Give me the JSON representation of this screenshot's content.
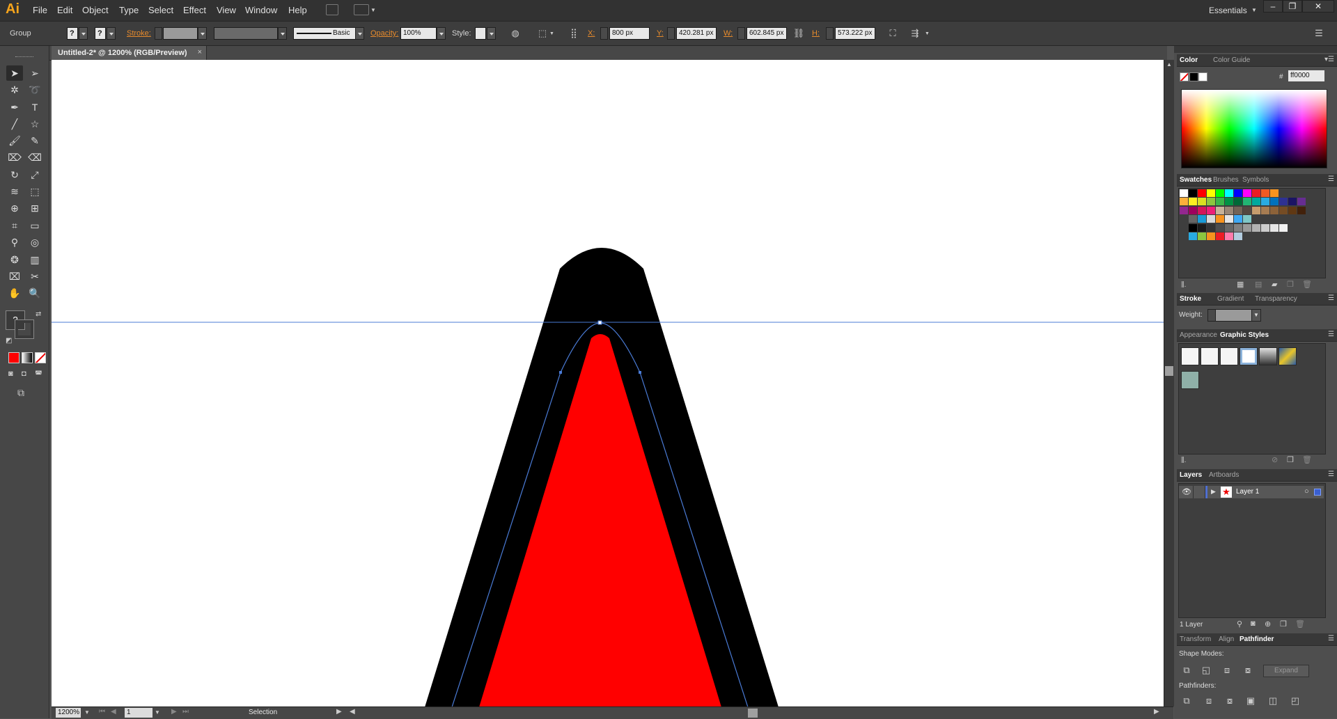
{
  "app": {
    "logo": "Ai"
  },
  "menu": [
    "File",
    "Edit",
    "Object",
    "Type",
    "Select",
    "Effect",
    "View",
    "Window",
    "Help"
  ],
  "workspace": {
    "label": "Essentials"
  },
  "window_buttons": [
    "–",
    "❐",
    "✕"
  ],
  "control_bar": {
    "selection_type": "Group",
    "stroke_label": "Stroke:",
    "brush_label": "Basic",
    "opacity_label": "Opacity:",
    "opacity_value": "100%",
    "style_label": "Style:",
    "x_label": "X:",
    "x_value": "800 px",
    "y_label": "Y:",
    "y_value": "420.281 px",
    "w_label": "W:",
    "w_value": "602.845 px",
    "h_label": "H:",
    "h_value": "573.222 px"
  },
  "document": {
    "tab_title": "Untitled-2* @ 1200% (RGB/Preview)",
    "close_glyph": "×",
    "fill_color": "#ff0000",
    "stroke_color": "#000000",
    "guide_color": "#4a7bd6"
  },
  "status_bar": {
    "zoom": "1200%",
    "artboard": "1",
    "tool": "Selection"
  },
  "panels": {
    "color": {
      "tabs": [
        "Color",
        "Color Guide"
      ],
      "hex_label": "#",
      "hex_value": "ff0000"
    },
    "swatches": {
      "tabs": [
        "Swatches",
        "Brushes",
        "Symbols"
      ],
      "rows": [
        [
          "#ffffff",
          "#000000",
          "#ff0000",
          "#ffff00",
          "#00ff00",
          "#00ffff",
          "#0000ff",
          "#ff00ff",
          "#ed1c24",
          "#f15a24",
          "#f7931e"
        ],
        [
          "#fbb03b",
          "#fcee21",
          "#d9e021",
          "#8cc63f",
          "#39b54a",
          "#009245",
          "#006837",
          "#22b573",
          "#00a99d",
          "#29abe2",
          "#0071bc",
          "#2e3192",
          "#1b1464",
          "#662d91"
        ],
        [
          "#93278f",
          "#9e005d",
          "#d4145a",
          "#ed1e79",
          "#c7b299",
          "#998675",
          "#736357",
          "#534741",
          "#c69c6d",
          "#a67c52",
          "#8c6239",
          "#754c24",
          "#603813",
          "#42210b"
        ],
        [
          "#666666",
          "#1a9bd7",
          "#d9d9d9",
          "#f7931e",
          "#e6e6e6",
          "#3fa9f5",
          "#7fc7c7"
        ],
        [
          "#000000",
          "#1a1a1a",
          "#333333",
          "#4d4d4d",
          "#666666",
          "#808080",
          "#999999",
          "#b3b3b3",
          "#cccccc",
          "#e6e6e6",
          "#f2f2f2"
        ],
        [
          "#29abe2",
          "#8cc63f",
          "#f7931e",
          "#ed1c24",
          "#ff7bac",
          "#b3cde0"
        ]
      ]
    },
    "stroke": {
      "tabs": [
        "Stroke",
        "Gradient",
        "Transparency"
      ],
      "weight_label": "Weight:"
    },
    "graphic_styles": {
      "tabs": [
        "Appearance",
        "Graphic Styles"
      ]
    },
    "layers": {
      "tabs": [
        "Layers",
        "Artboards"
      ],
      "layer_name": "Layer 1",
      "count_label": "1 Layer"
    },
    "pathfinder": {
      "tabs": [
        "Transform",
        "Align",
        "Pathfinder"
      ],
      "shape_modes_label": "Shape Modes:",
      "expand_label": "Expand",
      "pathfinders_label": "Pathfinders:"
    }
  }
}
